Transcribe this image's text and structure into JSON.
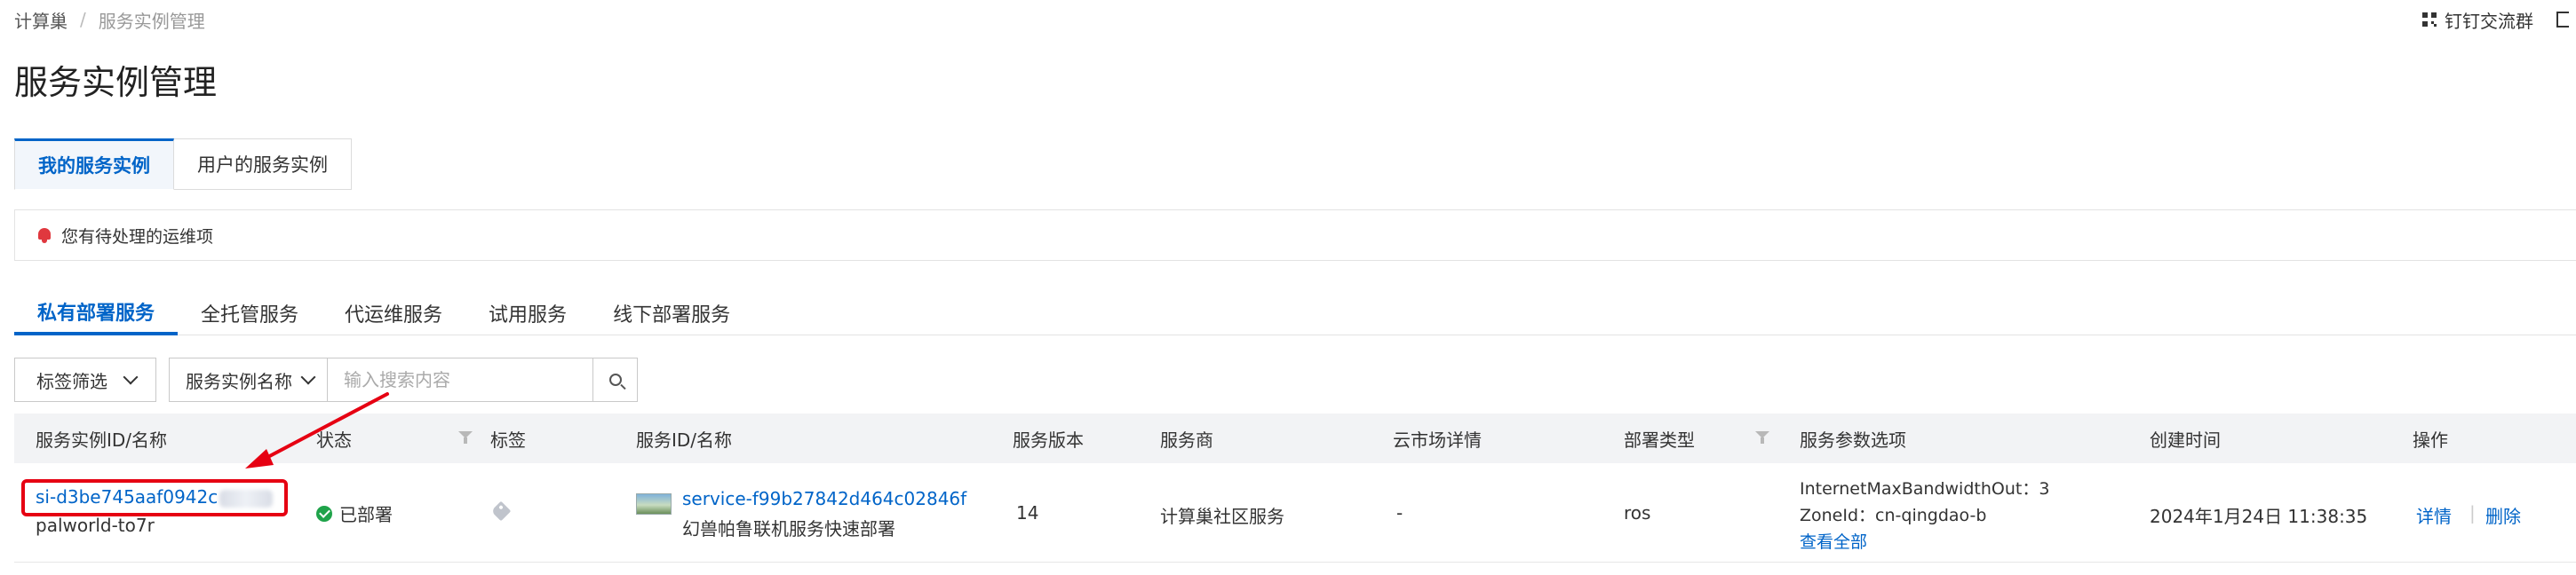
{
  "breadcrumb": {
    "root": "计算巢",
    "separator": "/",
    "current": "服务实例管理"
  },
  "topright": {
    "dingtalk_label": "钉钉交流群"
  },
  "page": {
    "title": "服务实例管理"
  },
  "tabs_level1": [
    {
      "label": "我的服务实例",
      "active": true
    },
    {
      "label": "用户的服务实例",
      "active": false
    }
  ],
  "notice": {
    "text": "您有待处理的运维项"
  },
  "tabs_level2": [
    {
      "label": "私有部署服务",
      "active": true
    },
    {
      "label": "全托管服务",
      "active": false
    },
    {
      "label": "代运维服务",
      "active": false
    },
    {
      "label": "试用服务",
      "active": false
    },
    {
      "label": "线下部署服务",
      "active": false
    }
  ],
  "filters": {
    "tag_filter_label": "标签筛选",
    "search_field_label": "服务实例名称",
    "search_placeholder": "输入搜索内容"
  },
  "table": {
    "columns": [
      "服务实例ID/名称",
      "状态",
      "标签",
      "服务ID/名称",
      "服务版本",
      "服务商",
      "云市场详情",
      "部署类型",
      "服务参数选项",
      "创建时间",
      "操作"
    ],
    "rows": [
      {
        "instance_id": "si-d3be745aaf0942c",
        "instance_name": "palworld-to7r",
        "status": "已部署",
        "service_id": "service-f99b27842d464c02846f",
        "service_name": "幻兽帕鲁联机服务快速部署",
        "version": "14",
        "provider": "计算巢社区服务",
        "market": "-",
        "deploy_type": "ros",
        "params_line1": "InternetMaxBandwidthOut：3",
        "params_line2": "ZoneId：cn-qingdao-b",
        "params_view_all": "查看全部",
        "created": "2024年1月24日 11:38:35",
        "action_detail": "详情",
        "action_delete": "删除"
      }
    ]
  },
  "colors": {
    "accent": "#0064c8",
    "success": "#1fa34a",
    "annotation": "#e60012",
    "notice_icon": "#e0383e"
  },
  "icons": [
    "dingtalk-icon",
    "bell-icon",
    "chevron-down-icon",
    "search-icon",
    "filter-icon",
    "check-circle-icon",
    "tag-icon",
    "service-thumbnail"
  ]
}
